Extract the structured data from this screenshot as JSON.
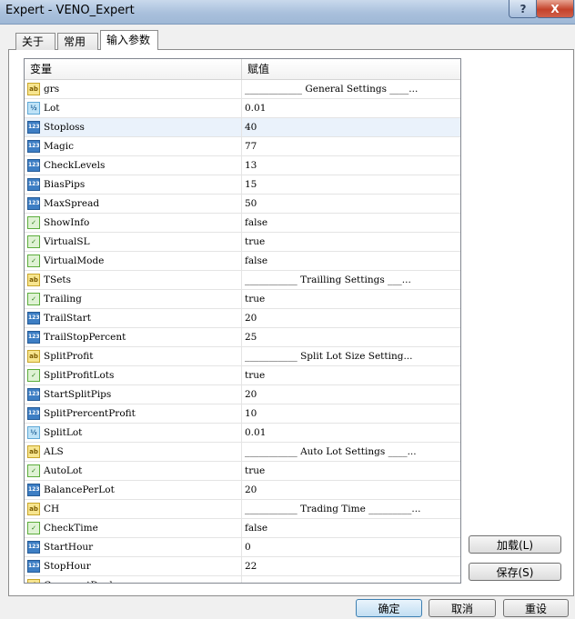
{
  "window": {
    "title": "Expert - VENO_Expert",
    "help_label": "?",
    "close_label": "X"
  },
  "tabs": [
    "关于",
    "常用",
    "输入参数"
  ],
  "grid": {
    "col_name": "变量",
    "col_value": "赋值",
    "rows": [
      {
        "type": "string",
        "icon": "string-icon",
        "name": "grs",
        "value": "____________ General Settings ____..."
      },
      {
        "type": "double",
        "icon": "double-icon",
        "name": "Lot",
        "value": "0.01"
      },
      {
        "type": "int",
        "icon": "int-icon",
        "name": "Stoploss",
        "value": "40"
      },
      {
        "type": "int",
        "icon": "int-icon",
        "name": "Magic",
        "value": "77"
      },
      {
        "type": "int",
        "icon": "int-icon",
        "name": "CheckLevels",
        "value": "13"
      },
      {
        "type": "int",
        "icon": "int-icon",
        "name": "BiasPips",
        "value": "15"
      },
      {
        "type": "int",
        "icon": "int-icon",
        "name": "MaxSpread",
        "value": "50"
      },
      {
        "type": "bool",
        "icon": "bool-icon",
        "name": "ShowInfo",
        "value": "false"
      },
      {
        "type": "bool",
        "icon": "bool-icon",
        "name": "VirtualSL",
        "value": "true"
      },
      {
        "type": "bool",
        "icon": "bool-icon",
        "name": "VirtualMode",
        "value": "false"
      },
      {
        "type": "string",
        "icon": "string-icon",
        "name": "TSets",
        "value": "___________ Trailling Settings ___..."
      },
      {
        "type": "bool",
        "icon": "bool-icon",
        "name": "Trailing",
        "value": "true"
      },
      {
        "type": "int",
        "icon": "int-icon",
        "name": "TrailStart",
        "value": "20"
      },
      {
        "type": "int",
        "icon": "int-icon",
        "name": "TrailStopPercent",
        "value": "25"
      },
      {
        "type": "string",
        "icon": "string-icon",
        "name": "SplitProfit",
        "value": "___________ Split Lot Size Setting..."
      },
      {
        "type": "bool",
        "icon": "bool-icon",
        "name": "SplitProfitLots",
        "value": "true"
      },
      {
        "type": "int",
        "icon": "int-icon",
        "name": "StartSplitPips",
        "value": "20"
      },
      {
        "type": "int",
        "icon": "int-icon",
        "name": "SplitPrercentProfit",
        "value": "10"
      },
      {
        "type": "double",
        "icon": "double-icon",
        "name": "SplitLot",
        "value": "0.01"
      },
      {
        "type": "string",
        "icon": "string-icon",
        "name": "ALS",
        "value": "___________ Auto Lot Settings ____..."
      },
      {
        "type": "bool",
        "icon": "bool-icon",
        "name": "AutoLot",
        "value": "true"
      },
      {
        "type": "int",
        "icon": "int-icon",
        "name": "BalancePerLot",
        "value": "20"
      },
      {
        "type": "string",
        "icon": "string-icon",
        "name": "CH",
        "value": "___________ Trading Time _________..."
      },
      {
        "type": "bool",
        "icon": "bool-icon",
        "name": "CheckTime",
        "value": "false"
      },
      {
        "type": "int",
        "icon": "int-icon",
        "name": "StartHour",
        "value": "0"
      },
      {
        "type": "int",
        "icon": "int-icon",
        "name": "StopHour",
        "value": "22"
      },
      {
        "type": "string",
        "icon": "string-icon",
        "name": "CommentDeals",
        "value": ""
      }
    ],
    "selected_row": "Stoploss"
  },
  "side_buttons": {
    "load": "加载(L)",
    "save": "保存(S)"
  },
  "footer_buttons": {
    "ok": "确定",
    "cancel": "取消",
    "reset": "重设"
  },
  "icon_glyphs": {
    "string": "ab",
    "int": "123",
    "double": "½",
    "bool": "✓"
  }
}
